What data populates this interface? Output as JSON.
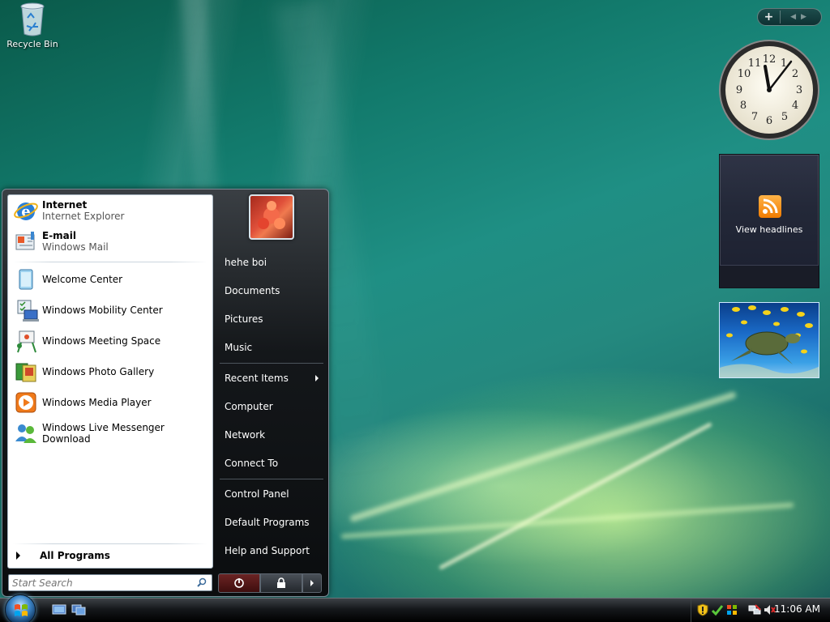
{
  "desktop": {
    "icons": [
      {
        "label": "Recycle Bin",
        "icon": "recycle-bin-icon"
      }
    ]
  },
  "gadgets": {
    "headlines_label": "View headlines"
  },
  "start_menu": {
    "pinned": [
      {
        "title": "Internet",
        "subtitle": "Internet Explorer",
        "icon": "internet-explorer-icon"
      },
      {
        "title": "E-mail",
        "subtitle": "Windows Mail",
        "icon": "windows-mail-icon"
      }
    ],
    "recent": [
      {
        "label": "Welcome Center",
        "icon": "welcome-center-icon"
      },
      {
        "label": "Windows Mobility Center",
        "icon": "mobility-center-icon"
      },
      {
        "label": "Windows Meeting Space",
        "icon": "meeting-space-icon"
      },
      {
        "label": "Windows Photo Gallery",
        "icon": "photo-gallery-icon"
      },
      {
        "label": "Windows Media Player",
        "icon": "media-player-icon"
      },
      {
        "label": "Windows Live Messenger Download",
        "icon": "messenger-icon"
      }
    ],
    "all_programs": "All Programs",
    "search_placeholder": "Start Search",
    "right_items": [
      {
        "label": "hehe boi"
      },
      {
        "label": "Documents"
      },
      {
        "label": "Pictures"
      },
      {
        "label": "Music"
      },
      {
        "label": "Recent Items",
        "submenu": true
      },
      {
        "label": "Computer"
      },
      {
        "label": "Network"
      },
      {
        "label": "Connect To"
      },
      {
        "label": "Control Panel"
      },
      {
        "label": "Default Programs"
      },
      {
        "label": "Help and Support"
      }
    ]
  },
  "taskbar": {
    "clock": "11:06 AM"
  }
}
